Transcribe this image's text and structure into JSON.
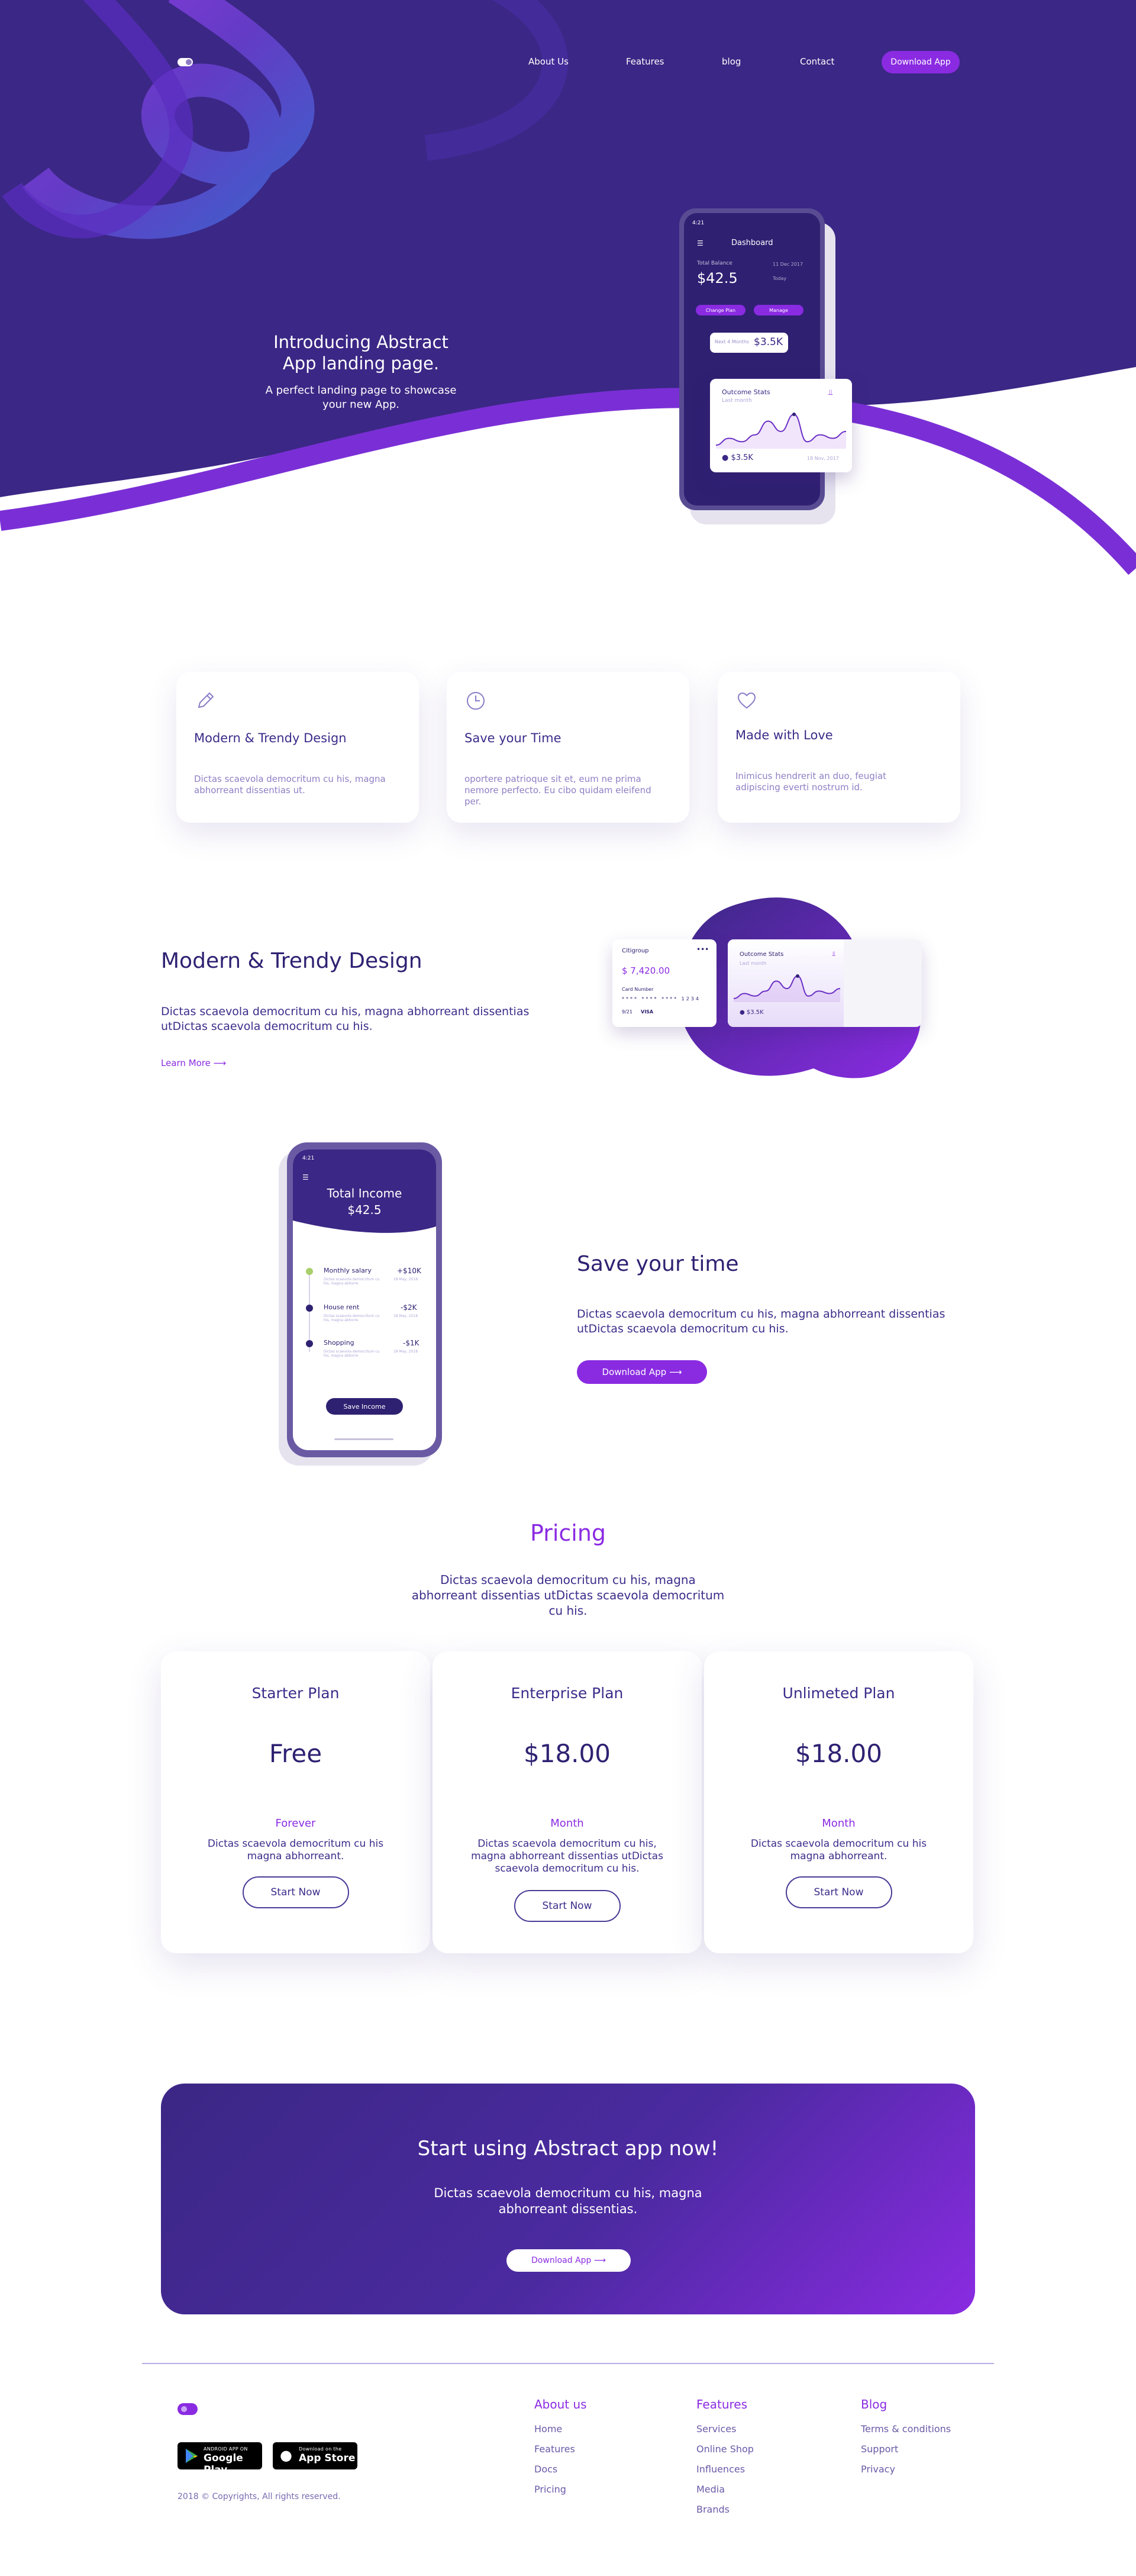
{
  "nav": {
    "links": [
      "About Us",
      "Features",
      "blog",
      "Contact"
    ],
    "cta": "Download App"
  },
  "hero": {
    "title": "Introducing Abstract App landing page.",
    "subtitle": "A perfect landing page to showcase your new App."
  },
  "hero_phone": {
    "time": "4:21",
    "header": "Dashboard",
    "balance_label": "Total Balance",
    "balance_value": "$42.5",
    "side_a": "11 Dec 2017",
    "side_b": "Today",
    "change_plan": "Change Plan",
    "manage": "Manage",
    "mini_label": "Next 4 Months",
    "mini_value": "$3.5K",
    "card_title": "Outcome Stats",
    "card_sub": "Last month",
    "card_value": "$3.5K",
    "card_date": "18 Nov, 2017",
    "chart": [
      12,
      16,
      14,
      18,
      26,
      20,
      30,
      14,
      18,
      16,
      20
    ]
  },
  "features": [
    {
      "icon": "pencil-icon",
      "title": "Modern & Trendy Design",
      "desc": "Dictas scaevola democritum cu his, magna abhorreant dissentias ut."
    },
    {
      "icon": "clock-icon",
      "title": "Save your Time",
      "desc": "oportere patrioque sit et, eum ne prima nemore perfecto. Eu cibo quidam eleifend per."
    },
    {
      "icon": "heart-icon",
      "title": "Made with Love",
      "desc": "Inimicus hendrerit an duo, feugiat adipiscing everti nostrum id."
    }
  ],
  "modern": {
    "title": "Modern & Trendy Design",
    "desc": "Dictas scaevola democritum cu his, magna abhorreant dissentias utDictas scaevola democritum cu his.",
    "link": "Learn More ⟶",
    "bank_card": {
      "bank": "Citigroup",
      "amount": "$ 7,420.00",
      "label": "Card Number",
      "digits": "**** **** **** 1234",
      "exp": "9/21",
      "brand": "VISA"
    },
    "stats_card": {
      "title": "Outcome Stats",
      "sub": "Last month",
      "value": "$3.5K"
    }
  },
  "save": {
    "title": "Save your time",
    "desc": "Dictas scaevola democritum cu his, magna abhorreant dissentias utDictas scaevola democritum cu his.",
    "button": "Download App ⟶",
    "phone": {
      "time": "4:21",
      "header": "Total Income",
      "amount": "$42.5",
      "items": [
        {
          "title": "Monthly salary",
          "desc": "Dictas scaevola democritum cu his, magna abhorre",
          "amount": "+$10K",
          "date": "18 May, 2018"
        },
        {
          "title": "House rent",
          "desc": "Dictas scaevola democritum cu his, magna abhorre",
          "amount": "-$2K",
          "date": "18 May, 2018"
        },
        {
          "title": "Shopping",
          "desc": "Dictas scaevola democritum cu his, magna abhorre",
          "amount": "-$1K",
          "date": "18 May, 2018"
        }
      ],
      "button": "Save Income"
    }
  },
  "pricing": {
    "title": "Pricing",
    "desc": "Dictas scaevola democritum cu his, magna abhorreant dissentias utDictas scaevola democritum cu his.",
    "plans": [
      {
        "name": "Starter Plan",
        "price": "Free",
        "period": "Forever",
        "desc": "Dictas scaevola democritum cu his magna abhorreant.",
        "button": "Start Now"
      },
      {
        "name": "Enterprise Plan",
        "price": "$18.00",
        "period": "Month",
        "desc": "Dictas scaevola democritum cu his, magna abhorreant dissentias utDictas scaevola democritum cu his.",
        "button": "Start Now"
      },
      {
        "name": "Unlimeted Plan",
        "price": "$18.00",
        "period": "Month",
        "desc": "Dictas scaevola democritum cu his magna abhorreant.",
        "button": "Start Now"
      }
    ]
  },
  "cta": {
    "title": "Start using Abstract app now!",
    "desc": "Dictas scaevola democritum cu his, magna abhorreant dissentias.",
    "button": "Download App ⟶"
  },
  "footer": {
    "google_small": "ANDROID APP ON",
    "google_big": "Google Play",
    "apple_small": "Download on the",
    "apple_big": "App Store",
    "copyright": "2018 © Copyrights, All rights reserved.",
    "columns": [
      {
        "title": "About us",
        "links": [
          "Home",
          "Features",
          "Docs",
          "Pricing"
        ]
      },
      {
        "title": "Features",
        "links": [
          "Services",
          "Online Shop",
          "Influences",
          "Media",
          "Brands"
        ]
      },
      {
        "title": "Blog",
        "links": [
          "Terms & conditions",
          "Support",
          "Privacy"
        ]
      }
    ]
  },
  "colors": {
    "primary": "#3b2785",
    "accent": "#8a2be2",
    "text": "#2f2172"
  }
}
